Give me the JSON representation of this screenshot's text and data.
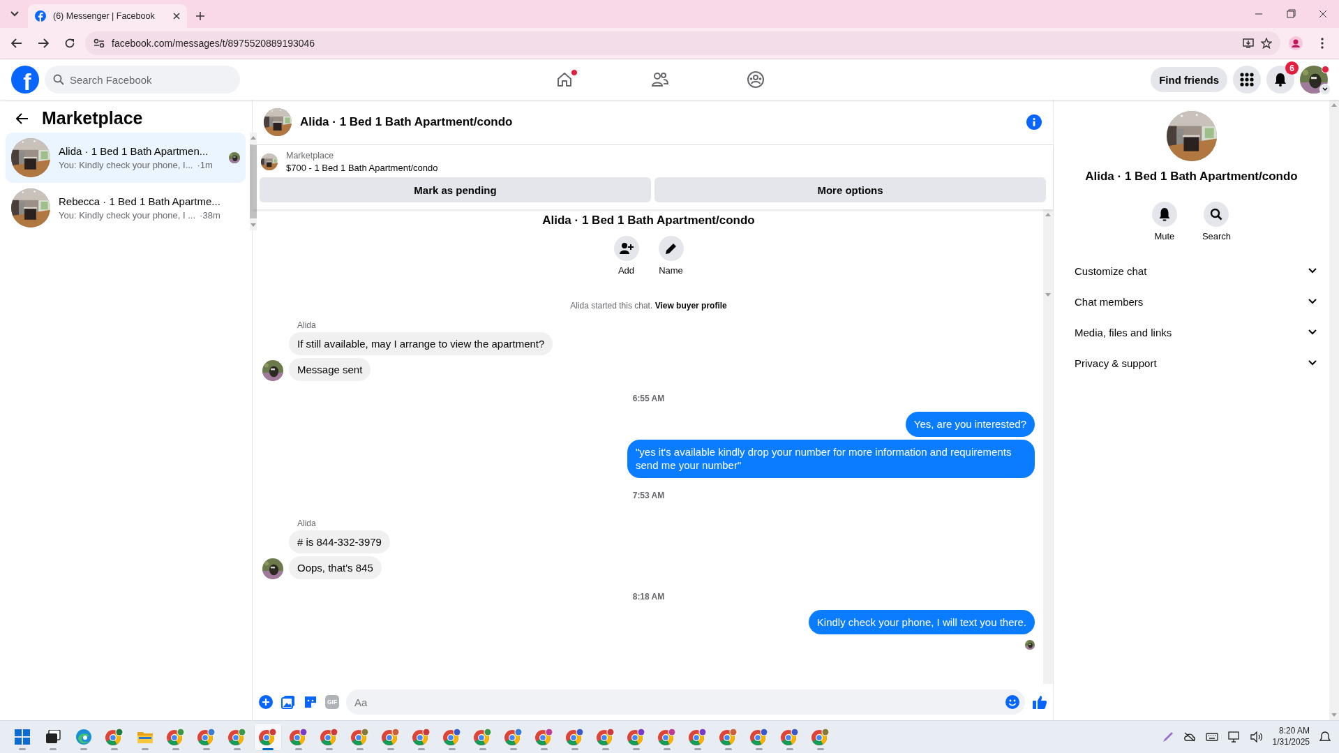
{
  "browser": {
    "tab_title": "(6) Messenger | Facebook",
    "url": "facebook.com/messages/t/8975520889193046"
  },
  "header": {
    "logo_text": "f",
    "search": {
      "placeholder": "Search Facebook"
    },
    "nav": [
      {
        "kind": "home",
        "selected": false,
        "dot": true
      },
      {
        "kind": "friends",
        "selected": false,
        "dot": false
      },
      {
        "kind": "groups",
        "selected": false,
        "dot": false
      }
    ],
    "find_friends": "Find friends",
    "notifications_badge": "6"
  },
  "sidebar": {
    "title": "Marketplace",
    "items": [
      {
        "title": "Alida · 1 Bed 1 Bath Apartmen...",
        "preview": "You: Kindly check your phone, I...",
        "time": "·1m",
        "selected": true,
        "seen": true
      },
      {
        "title": "Rebecca · 1 Bed 1 Bath Apartme...",
        "preview": "You: Kindly check your phone, I ...",
        "time": "·38m",
        "selected": false,
        "seen": false
      }
    ]
  },
  "chat": {
    "title": "Alida · 1 Bed 1 Bath Apartment/condo",
    "listing": {
      "label": "Marketplace",
      "name": "$700 - 1 Bed 1 Bath Apartment/condo",
      "buttons": [
        "Mark as pending",
        "More options"
      ]
    },
    "intro": {
      "title": "Alida · 1 Bed 1 Bath Apartment/condo",
      "actions": [
        {
          "kind": "add",
          "label": "Add"
        },
        {
          "kind": "name",
          "label": "Name"
        }
      ],
      "note": "Alida started this chat.",
      "link": "View buyer profile"
    },
    "messages": [
      {
        "kind": "sender",
        "text": "Alida"
      },
      {
        "kind": "in",
        "text": "If still available, may I arrange to view the apartment?",
        "avatar": false
      },
      {
        "kind": "in",
        "text": "Message sent",
        "avatar": true
      },
      {
        "kind": "time",
        "text": "6:55 AM"
      },
      {
        "kind": "out",
        "text": "Yes, are you interested?",
        "seen": false
      },
      {
        "kind": "out",
        "text": "\"yes it's available kindly drop your number for more information and requirements send me your number\"",
        "seen": false
      },
      {
        "kind": "time",
        "text": "7:53 AM"
      },
      {
        "kind": "sender",
        "text": "Alida"
      },
      {
        "kind": "in",
        "text": "# is 844-332-3979",
        "avatar": false
      },
      {
        "kind": "in",
        "text": "Oops, that's 845",
        "avatar": true
      },
      {
        "kind": "time",
        "text": "8:18 AM"
      },
      {
        "kind": "out",
        "text": "Kindly check your phone, I will text you there.",
        "seen": true
      }
    ],
    "composer": {
      "gif_label": "GIF",
      "placeholder": "Aa"
    }
  },
  "details": {
    "title": "Alida · 1 Bed 1 Bath Apartment/condo",
    "actions": [
      {
        "kind": "mute",
        "label": "Mute"
      },
      {
        "kind": "search",
        "label": "Search"
      }
    ],
    "sections": [
      {
        "label": "Customize chat",
        "expanded": false
      },
      {
        "label": "Chat members",
        "expanded": false
      },
      {
        "label": "Media, files and links",
        "expanded": false
      },
      {
        "label": "Privacy & support",
        "expanded": false
      }
    ]
  },
  "taskbar": {
    "apps": [
      {
        "kind": "start",
        "selected": false
      },
      {
        "kind": "taskview",
        "selected": false
      },
      {
        "kind": "edge",
        "selected": false
      },
      {
        "kind": "chrome",
        "color": "#1e7a3c",
        "selected": false
      },
      {
        "kind": "folder",
        "selected": false
      },
      {
        "kind": "chrome",
        "color": "#3a9a4a",
        "selected": false
      },
      {
        "kind": "chrome",
        "color": "#3a7bd5",
        "selected": false
      },
      {
        "kind": "chrome",
        "color": "#3a9a4a",
        "selected": false
      },
      {
        "kind": "chrome",
        "color": "#d03a3a",
        "selected": true
      },
      {
        "kind": "chrome",
        "color": "#7a3ad0",
        "selected": false
      },
      {
        "kind": "chrome",
        "color": "#d03a3a",
        "selected": false
      },
      {
        "kind": "chrome",
        "color": "#8a7a3a",
        "selected": false
      },
      {
        "kind": "chrome",
        "color": "#d0603a",
        "selected": false
      },
      {
        "kind": "chrome",
        "color": "#d03a3a",
        "selected": false
      },
      {
        "kind": "chrome",
        "color": "#3a5ad0",
        "selected": false
      },
      {
        "kind": "chrome",
        "color": "#3a9a4a",
        "selected": false
      },
      {
        "kind": "chrome",
        "color": "#3a7bd5",
        "selected": false
      },
      {
        "kind": "chrome",
        "color": "#c03a9a",
        "selected": false
      },
      {
        "kind": "chrome",
        "color": "#3a5ad0",
        "selected": false
      },
      {
        "kind": "chrome",
        "color": "#d03a3a",
        "selected": false
      },
      {
        "kind": "chrome",
        "color": "#7a3ad0",
        "selected": false
      },
      {
        "kind": "chrome",
        "color": "#c03a9a",
        "selected": false
      },
      {
        "kind": "chrome",
        "color": "#7a3ad0",
        "selected": false
      },
      {
        "kind": "chrome",
        "color": "#d0603a",
        "selected": false
      },
      {
        "kind": "chrome",
        "color": "#3a5ad0",
        "selected": false
      },
      {
        "kind": "chrome",
        "color": "#3a5ad0",
        "selected": false
      },
      {
        "kind": "chrome",
        "color": "#8a7a3a",
        "selected": false
      }
    ],
    "time": "8:20 AM",
    "date": "1/31/2025"
  }
}
